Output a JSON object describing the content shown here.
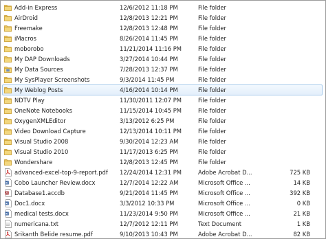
{
  "files": [
    {
      "name": "Add-in Express",
      "date": "12/6/2012 11:18 PM",
      "type": "File folder",
      "size": "",
      "icon": "folder-icon"
    },
    {
      "name": "AirDroid",
      "date": "12/8/2013 12:21 PM",
      "type": "File folder",
      "size": "",
      "icon": "folder-icon"
    },
    {
      "name": "Freemake",
      "date": "12/8/2013 12:48 PM",
      "type": "File folder",
      "size": "",
      "icon": "folder-icon"
    },
    {
      "name": "iMacros",
      "date": "8/26/2014 11:45 PM",
      "type": "File folder",
      "size": "",
      "icon": "folder-icon"
    },
    {
      "name": "moborobo",
      "date": "11/21/2014 11:16 PM",
      "type": "File folder",
      "size": "",
      "icon": "folder-icon"
    },
    {
      "name": "My DAP Downloads",
      "date": "3/27/2014 10:44 PM",
      "type": "File folder",
      "size": "",
      "icon": "folder-icon"
    },
    {
      "name": "My Data Sources",
      "date": "7/28/2013 12:37 PM",
      "type": "File folder",
      "size": "",
      "icon": "special-folder-icon"
    },
    {
      "name": "My SysPlayer Screenshots",
      "date": "9/3/2014 11:45 PM",
      "type": "File folder",
      "size": "",
      "icon": "folder-icon"
    },
    {
      "name": "My Weblog Posts",
      "date": "4/16/2014 10:14 PM",
      "type": "File folder",
      "size": "",
      "icon": "folder-icon"
    },
    {
      "name": "NDTV Play",
      "date": "11/30/2011 12:07 PM",
      "type": "File folder",
      "size": "",
      "icon": "folder-icon"
    },
    {
      "name": "OneNote Notebooks",
      "date": "11/15/2014 10:45 PM",
      "type": "File folder",
      "size": "",
      "icon": "folder-icon"
    },
    {
      "name": "OxygenXMLEditor",
      "date": "3/13/2012 6:25 PM",
      "type": "File folder",
      "size": "",
      "icon": "folder-icon"
    },
    {
      "name": "Video Download Capture",
      "date": "12/13/2014 10:11 PM",
      "type": "File folder",
      "size": "",
      "icon": "folder-icon"
    },
    {
      "name": "Visual Studio 2008",
      "date": "9/30/2014 12:23 AM",
      "type": "File folder",
      "size": "",
      "icon": "folder-icon"
    },
    {
      "name": "Visual Studio 2010",
      "date": "11/17/2013 6:25 PM",
      "type": "File folder",
      "size": "",
      "icon": "folder-icon"
    },
    {
      "name": "Wondershare",
      "date": "12/8/2013 12:45 PM",
      "type": "File folder",
      "size": "",
      "icon": "folder-icon"
    },
    {
      "name": "advanced-excel-top-9-report.pdf",
      "date": "12/24/2014 12:31 PM",
      "type": "Adobe Acrobat D...",
      "size": "725 KB",
      "icon": "pdf-icon"
    },
    {
      "name": "Cobo Launcher Review.docx",
      "date": "12/7/2014 12:22 AM",
      "type": "Microsoft Office ...",
      "size": "14 KB",
      "icon": "word-doc-icon"
    },
    {
      "name": "Database1.accdb",
      "date": "9/21/2014 11:45 PM",
      "type": "Microsoft Office ...",
      "size": "392 KB",
      "icon": "access-db-icon"
    },
    {
      "name": "Doc1.docx",
      "date": "3/3/2012 10:33 PM",
      "type": "Microsoft Office ...",
      "size": "0 KB",
      "icon": "word-doc-icon"
    },
    {
      "name": "medical tests.docx",
      "date": "11/23/2014 9:50 PM",
      "type": "Microsoft Office ...",
      "size": "21 KB",
      "icon": "word-doc-icon"
    },
    {
      "name": "numericana.txt",
      "date": "12/7/2012 12:11 PM",
      "type": "Text Document",
      "size": "1 KB",
      "icon": "text-file-icon"
    },
    {
      "name": "Srikanth Belide resume.pdf",
      "date": "9/10/2013 10:43 PM",
      "type": "Adobe Acrobat D...",
      "size": "82 KB",
      "icon": "pdf-icon"
    }
  ],
  "selected_index": 8,
  "colors": {
    "folder": "#e8c25a",
    "folder_edge": "#c79a2c",
    "selection_border": "#a9cbec",
    "pdf": "#c8201e",
    "word": "#2b5797",
    "access": "#a4373a"
  }
}
